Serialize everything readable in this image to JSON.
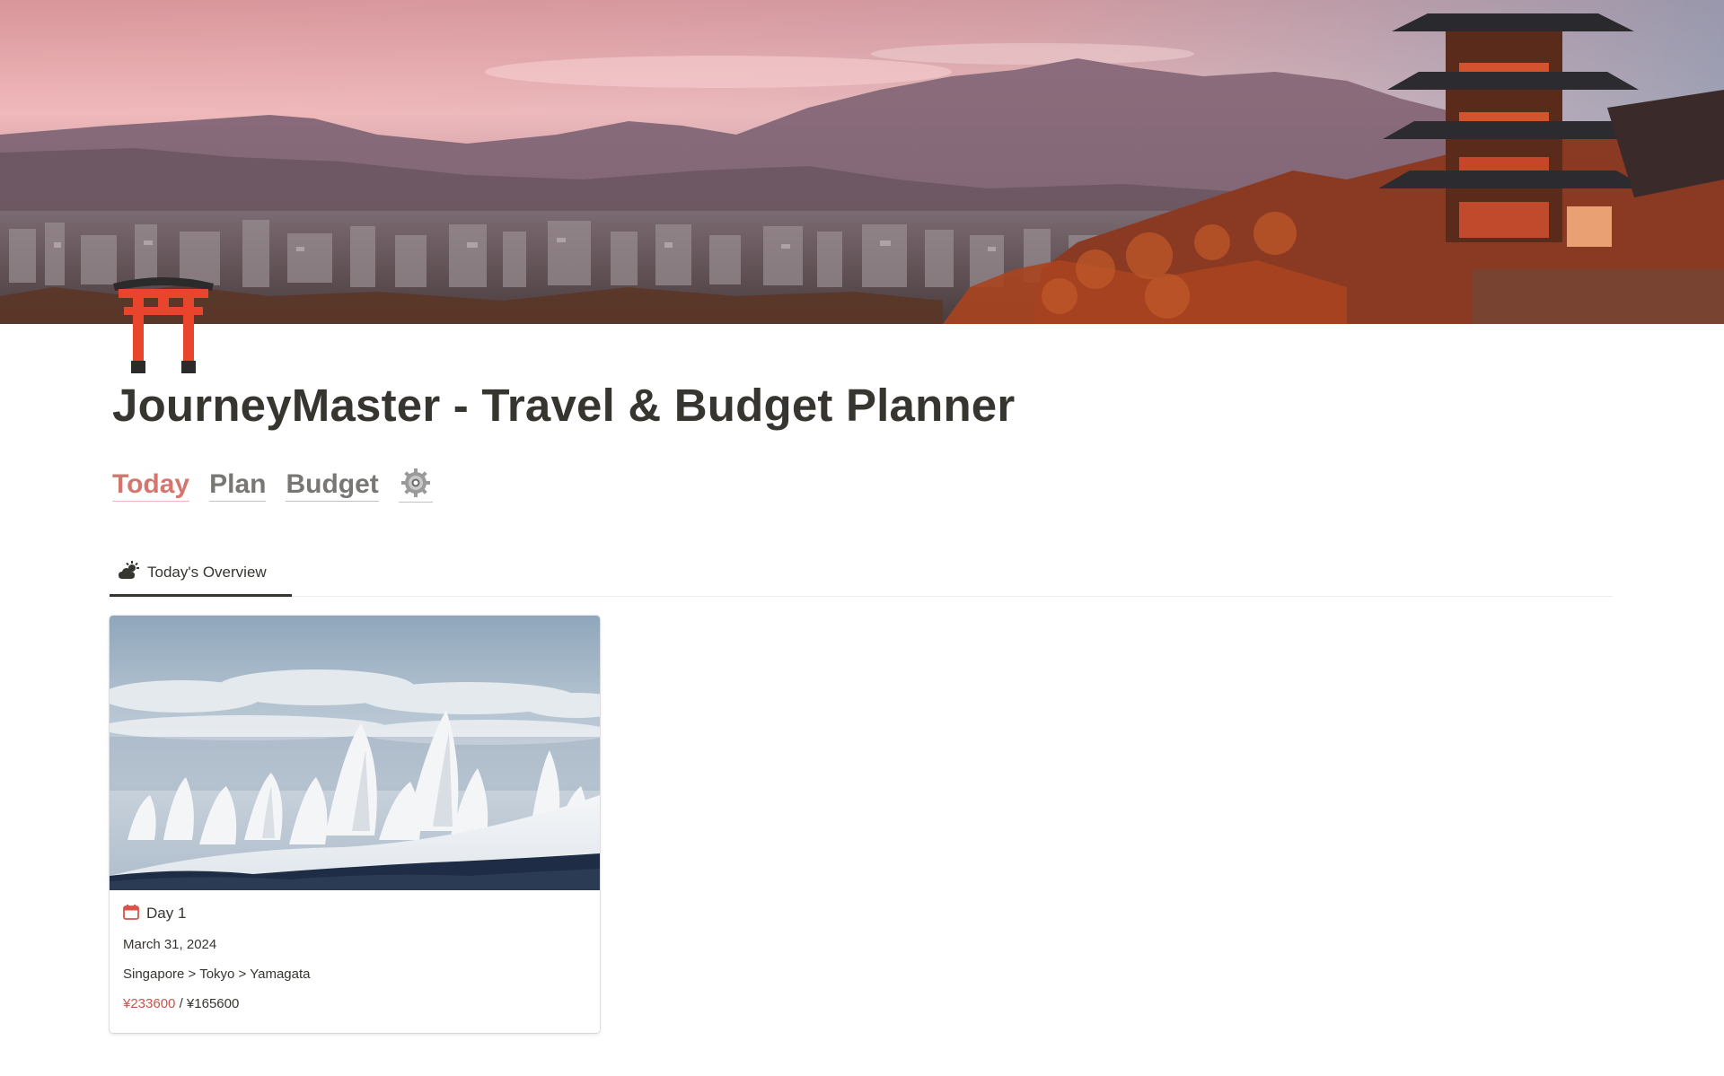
{
  "page": {
    "title": "JourneyMaster - Travel & Budget Planner",
    "icon": "torii-gate-icon"
  },
  "nav": {
    "links": [
      {
        "label": "Today",
        "active": true
      },
      {
        "label": "Plan",
        "active": false
      },
      {
        "label": "Budget",
        "active": false
      }
    ],
    "settings_icon": "gear-icon"
  },
  "tabs": [
    {
      "label": "Today's Overview",
      "icon": "sun-behind-cloud-icon",
      "active": true
    }
  ],
  "cards": [
    {
      "title": "Day 1",
      "title_icon": "calendar-icon",
      "date": "March 31, 2024",
      "route": "Singapore > Tokyo > Yamagata",
      "spent": "¥233600",
      "separator": " / ",
      "budget": "¥165600"
    }
  ],
  "colors": {
    "accent": "#d4756f",
    "over_budget": "#c4554d",
    "text": "#37352f",
    "muted": "#787774"
  }
}
